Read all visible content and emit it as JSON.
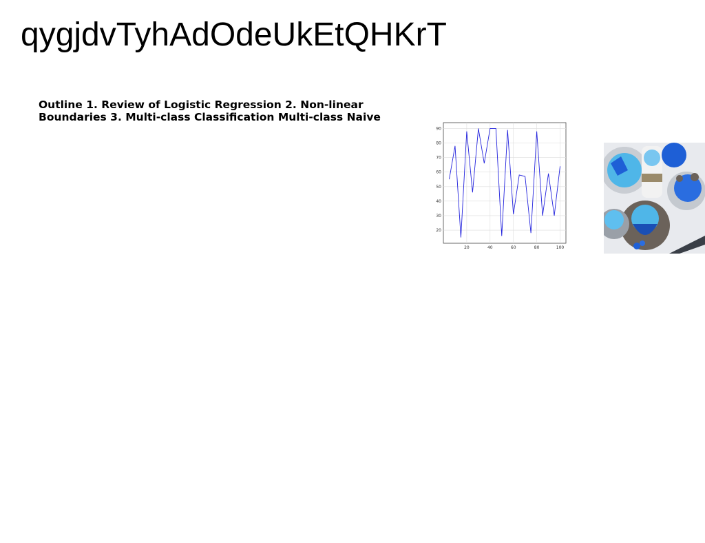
{
  "slide": {
    "title": "qygjdvTyhAdOdeUkEtQHKrT",
    "outline_text": "Outline 1. Review of Logistic Regression 2. Non-linear Boundaries 3. Multi-class Classification Multi-class Naive"
  },
  "chart_data": {
    "type": "line",
    "x": [
      5,
      10,
      15,
      20,
      25,
      30,
      35,
      40,
      45,
      50,
      55,
      60,
      65,
      70,
      75,
      80,
      85,
      90,
      95,
      100
    ],
    "series": [
      {
        "values": [
          55,
          78,
          15,
          88,
          46,
          90,
          66,
          90,
          90,
          16,
          89,
          31,
          58,
          57,
          18,
          88,
          30,
          59,
          30,
          64
        ],
        "color": "#2222dd"
      }
    ],
    "xticks": [
      20,
      40,
      60,
      80,
      100
    ],
    "yticks": [
      20,
      30,
      40,
      50,
      60,
      70,
      80,
      90
    ],
    "xlim": [
      0,
      105
    ],
    "ylim": [
      11,
      94
    ],
    "grid": true
  },
  "photo": {
    "subject": "blue frosted desserts and drinks on a table",
    "palette": [
      "#4fb6e8",
      "#1e5fd6",
      "#d9dde3",
      "#6b625a",
      "#f2f2f2"
    ]
  }
}
